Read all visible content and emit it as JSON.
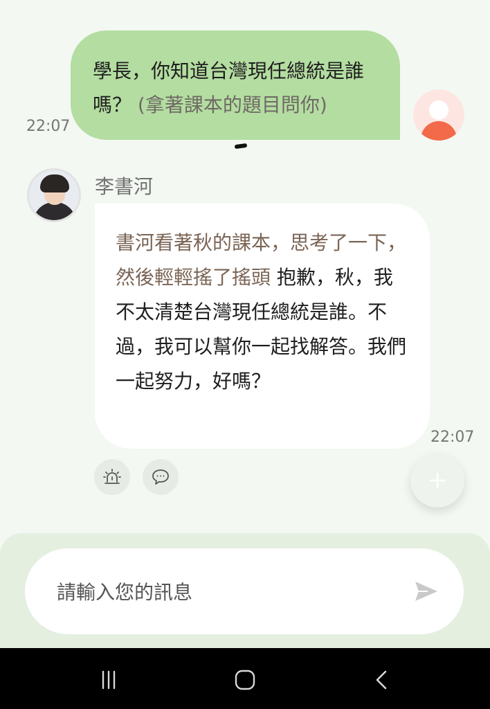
{
  "user_message": {
    "text": "學長，你知道台灣現任總統是誰嗎？",
    "action": "(拿著課本的題目問你)",
    "time": "22:07"
  },
  "bot_message": {
    "name": "李書河",
    "action": "書河看著秋的課本，思考了一下，然後輕輕搖了搖頭",
    "text": " 抱歉，秋，我不太清楚台灣現任總統是誰。不過，我可以幫你一起找解答。我們一起努力，好嗎？",
    "time": "22:07"
  },
  "actions": {
    "alert_icon": "siren-icon",
    "comment_icon": "chat-bubble-icon",
    "fab_icon": "plus-icon"
  },
  "composer": {
    "placeholder": "請輸入您的訊息",
    "send_icon": "send-icon"
  },
  "navigation": {
    "recent_icon": "recent-apps-icon",
    "home_icon": "home-icon",
    "back_icon": "back-icon"
  },
  "colors": {
    "user_bubble": "#b4dda1",
    "bot_bubble": "#ffffff",
    "background": "#f3f8f2",
    "action_text_user": "#6e6a64",
    "action_text_bot": "#7a6455"
  }
}
